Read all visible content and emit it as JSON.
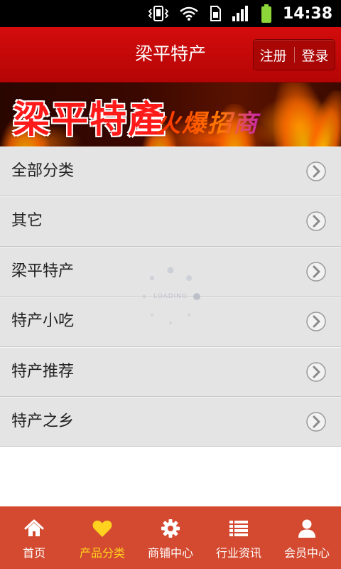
{
  "status_bar": {
    "time": "14:38"
  },
  "header": {
    "title": "梁平特产",
    "register_label": "注册",
    "login_label": "登录"
  },
  "banner": {
    "main_text": "梁平特產",
    "slogan": "火爆招商中！！！"
  },
  "categories": [
    {
      "label": "全部分类"
    },
    {
      "label": "其它"
    },
    {
      "label": "梁平特产"
    },
    {
      "label": "特产小吃"
    },
    {
      "label": "特产推荐"
    },
    {
      "label": "特产之乡"
    }
  ],
  "loading": {
    "text": "LOADING"
  },
  "tabbar": {
    "items": [
      {
        "label": "首页",
        "icon": "home-icon"
      },
      {
        "label": "产品分类",
        "icon": "heart-icon"
      },
      {
        "label": "商铺中心",
        "icon": "gear-icon"
      },
      {
        "label": "行业资讯",
        "icon": "list-icon"
      },
      {
        "label": "会员中心",
        "icon": "user-icon"
      }
    ],
    "active_index": 1
  },
  "colors": {
    "header": "#c80808",
    "tabbar": "#d44a30",
    "active_tab": "#ffd21f"
  }
}
